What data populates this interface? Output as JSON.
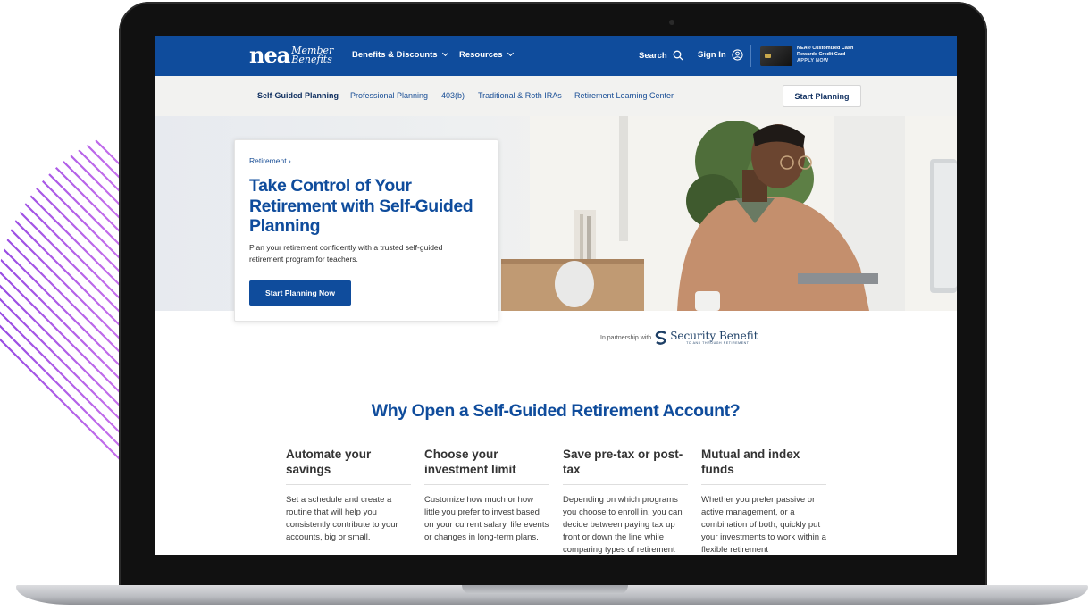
{
  "header": {
    "logo_mark": "nea",
    "logo_sub_1": "Member",
    "logo_sub_2": "Benefits",
    "nav": [
      "Benefits & Discounts",
      "Resources"
    ],
    "search_label": "Search",
    "signin_label": "Sign In",
    "promo_line1": "NEA® Customized Cash",
    "promo_line2": "Rewards Credit Card",
    "promo_cta": "APPLY NOW"
  },
  "subnav": {
    "links": [
      "Self-Guided Planning",
      "Professional Planning",
      "403(b)",
      "Traditional & Roth IRAs",
      "Retirement Learning Center"
    ],
    "active_index": 0,
    "start_button": "Start Planning"
  },
  "hero": {
    "breadcrumb": "Retirement ›",
    "title": "Take Control of Your Retirement with Self-Guided Planning",
    "description": "Plan your retirement confidently with a trusted self-guided retirement program for teachers.",
    "cta": "Start Planning Now"
  },
  "partner": {
    "text": "In partnership with",
    "name": "Security Benefit",
    "tagline": "TO AND THROUGH RETIREMENT"
  },
  "why": {
    "title": "Why Open a Self-Guided Retirement Account?",
    "features": [
      {
        "title": "Automate your savings",
        "body": "Set a schedule and create a routine that will help you consistently contribute to your accounts, big or small."
      },
      {
        "title": "Choose your investment limit",
        "body": "Customize how much or how little you prefer to invest based on your current salary, life events or changes in long-term plans."
      },
      {
        "title": "Save pre-tax or post-tax",
        "body": "Depending on which programs you choose to enroll in, you can decide between paying tax up front or down the line while comparing types of retirement"
      },
      {
        "title": "Mutual and index funds",
        "body": "Whether you prefer passive or active management, or a combination of both, quickly put your investments to work within a flexible retirement"
      }
    ]
  },
  "colors": {
    "brand_blue": "#0f4c9c",
    "dark_navy": "#0d2d5e",
    "stripe_purple": "#b25cf0"
  }
}
